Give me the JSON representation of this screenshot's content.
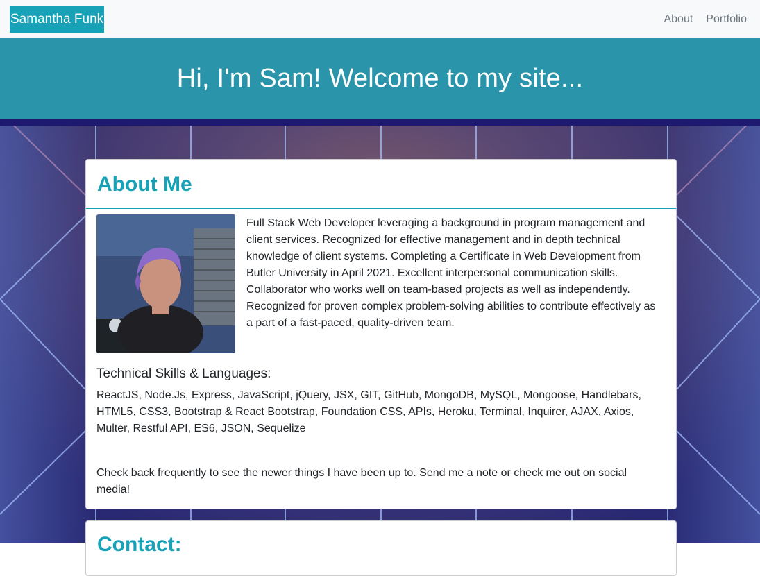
{
  "navbar": {
    "brand": "Samantha Funk",
    "links": [
      "About",
      "Portfolio"
    ]
  },
  "hero": {
    "heading": "Hi, I'm Sam! Welcome to my site..."
  },
  "about": {
    "title": "About Me",
    "bio": "Full Stack Web Developer leveraging a background in program management and client services. Recognized for effective management and in depth technical knowledge of client systems. Completing a Certificate in Web Development from Butler University in April 2021. Excellent interpersonal communication skills. Collaborator who works well on team-based projects as well as independently. Recognized for proven complex problem-solving abilities to contribute effectively as a part of a fast-paced, quality-driven team.",
    "skills_heading": "Technical Skills & Languages:",
    "skills": "ReactJS, Node.Js, Express, JavaScript, jQuery, JSX, GIT, GitHub, MongoDB, MySQL, Mongoose, Handlebars, HTML5, CSS3, Bootstrap & React Bootstrap, Foundation CSS, APIs, Heroku, Terminal, Inquirer, AJAX, Axios, Multer, Restful API, ES6, JSON, Sequelize",
    "note": "Check back frequently to see the newer things I have been up to. Send me a note or check me out on social media!"
  },
  "contact": {
    "title": "Contact:"
  },
  "colors": {
    "accent": "#17a2b8",
    "hero": "#2a94aa",
    "hero_stripe": "#1d1870",
    "navbar_bg": "#f8f9fa",
    "nav_link": "#6c757d"
  }
}
